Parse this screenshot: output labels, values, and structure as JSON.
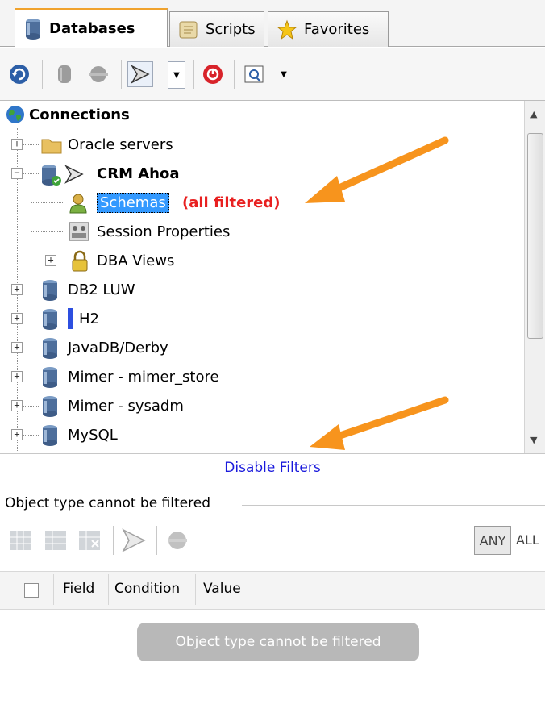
{
  "tabs": [
    {
      "label": "Databases",
      "icon": "database-icon",
      "active": true
    },
    {
      "label": "Scripts",
      "icon": "script-icon",
      "active": false
    },
    {
      "label": "Favorites",
      "icon": "star-icon",
      "active": false
    }
  ],
  "toolbar": {
    "icons": [
      "refresh-icon",
      "connect-icon",
      "disconnect-icon",
      "filter-icon",
      "filter-dropdown-icon",
      "stop-icon",
      "view-icon",
      "view-dropdown-icon"
    ]
  },
  "tree": {
    "root": "Connections",
    "items": [
      {
        "label": "Oracle servers"
      },
      {
        "label": "CRM Ahoa"
      },
      {
        "label": "Schemas"
      },
      {
        "label": "(all filtered)"
      },
      {
        "label": "Session Properties"
      },
      {
        "label": "DBA Views"
      },
      {
        "label": "DB2 LUW"
      },
      {
        "label": "H2"
      },
      {
        "label": "JavaDB/Derby"
      },
      {
        "label": "Mimer - mimer_store"
      },
      {
        "label": "Mimer - sysadm"
      },
      {
        "label": "MySQL"
      }
    ]
  },
  "filters": {
    "disable_link": "Disable Filters",
    "section_title": "Object type cannot be filtered",
    "any_label": "ANY",
    "all_label": "ALL",
    "columns": [
      "Field",
      "Condition",
      "Value"
    ],
    "empty_message": "Object type cannot be filtered"
  },
  "colors": {
    "accent": "#f7941d",
    "red_note": "#e82020",
    "link": "#1a1adc"
  }
}
